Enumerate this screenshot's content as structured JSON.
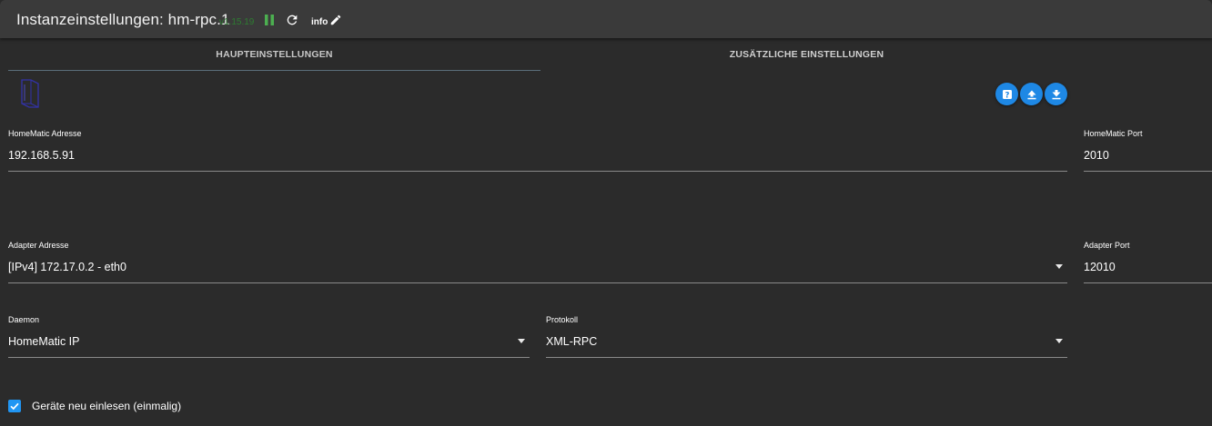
{
  "header": {
    "title": "Instanzeinstellungen: hm-rpc.1",
    "version": "v1.15.19",
    "info_label": "info"
  },
  "tabs": [
    {
      "label": "HAUPTEINSTELLUNGEN",
      "active": true
    },
    {
      "label": "ZUSÄTZLICHE EINSTELLUNGEN",
      "active": false
    }
  ],
  "actions": {
    "help_icon": "help-icon",
    "upload_icon": "upload-icon",
    "download_icon": "download-icon"
  },
  "fields": {
    "homematic_address": {
      "label": "HomeMatic Adresse",
      "value": "192.168.5.91"
    },
    "homematic_port": {
      "label": "HomeMatic Port",
      "value": "2010"
    },
    "adapter_address": {
      "label": "Adapter Adresse",
      "value": "[IPv4] 172.17.0.2 - eth0"
    },
    "adapter_port": {
      "label": "Adapter Port",
      "value": "12010"
    },
    "daemon": {
      "label": "Daemon",
      "value": "HomeMatic IP"
    },
    "protocol": {
      "label": "Protokoll",
      "value": "XML-RPC"
    }
  },
  "checkbox": {
    "label": "Geräte neu einlesen (einmalig)",
    "checked": true
  },
  "colors": {
    "accent": "#2196f3",
    "version_green": "#2e7d32",
    "pause_green": "#4caf50",
    "background": "#2b2b2b",
    "titlebar": "#3a3a3a"
  }
}
